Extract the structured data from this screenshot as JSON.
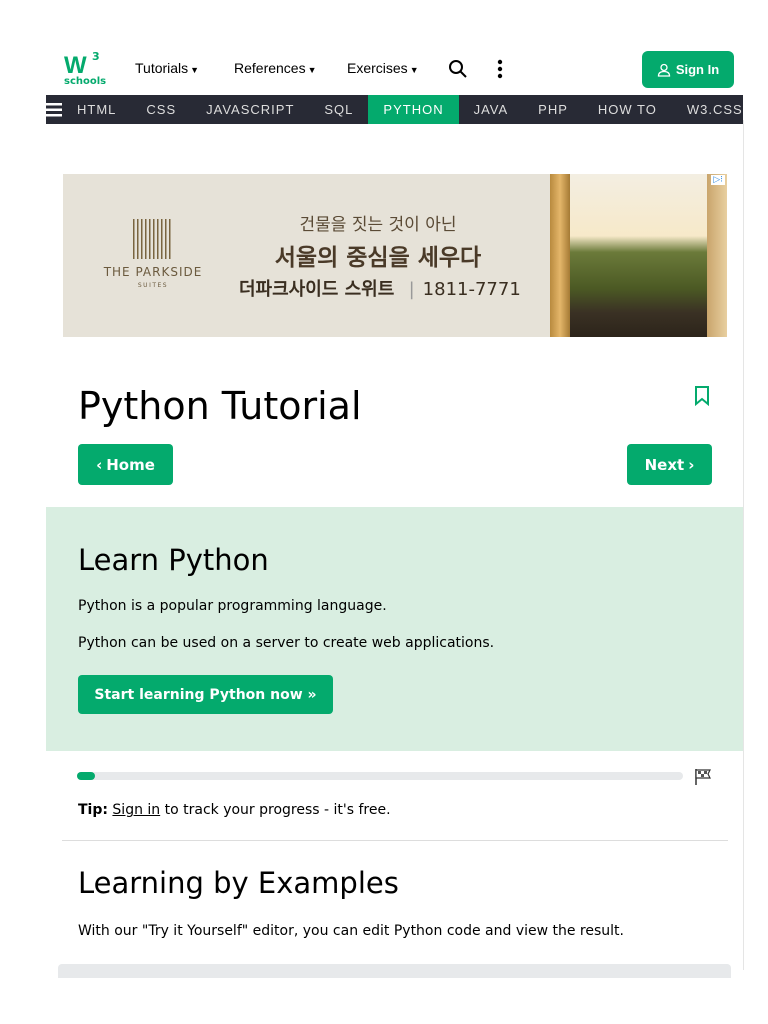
{
  "header": {
    "logo": {
      "mark": "W",
      "superscript": "3",
      "text": "schools"
    },
    "menus": [
      {
        "label": "Tutorials"
      },
      {
        "label": "References"
      },
      {
        "label": "Exercises"
      }
    ],
    "sign_in": "Sign In"
  },
  "nav": {
    "items": [
      "HTML",
      "CSS",
      "JAVASCRIPT",
      "SQL",
      "PYTHON",
      "JAVA",
      "PHP",
      "HOW TO",
      "W3.CSS"
    ],
    "active": "PYTHON"
  },
  "ad": {
    "brand": "THE PARKSIDE",
    "brand_sub": "SUITES",
    "line1": "건물을 짓는 것이 아닌",
    "line2": "서울의 중심을 세우다",
    "line3": "더파크사이드 스위트",
    "separator": "|",
    "phone": "1811-7771",
    "ad_choices": "▷⁝"
  },
  "page": {
    "title": "Python Tutorial",
    "home_button": "Home",
    "next_button": "Next"
  },
  "learn": {
    "heading": "Learn Python",
    "p1": "Python is a popular programming language.",
    "p2": "Python can be used on a server to create web applications.",
    "cta": "Start learning Python now »"
  },
  "progress": {
    "percent": 3
  },
  "tip": {
    "label": "Tip:",
    "link": "Sign in",
    "rest": " to track your progress - it's free."
  },
  "examples": {
    "heading": "Learning by Examples",
    "text": "With our \"Try it Yourself\" editor, you can edit Python code and view the result."
  },
  "colors": {
    "accent": "#04aa6d",
    "nav_bg": "#282a35",
    "learn_bg": "#d9eee1"
  }
}
